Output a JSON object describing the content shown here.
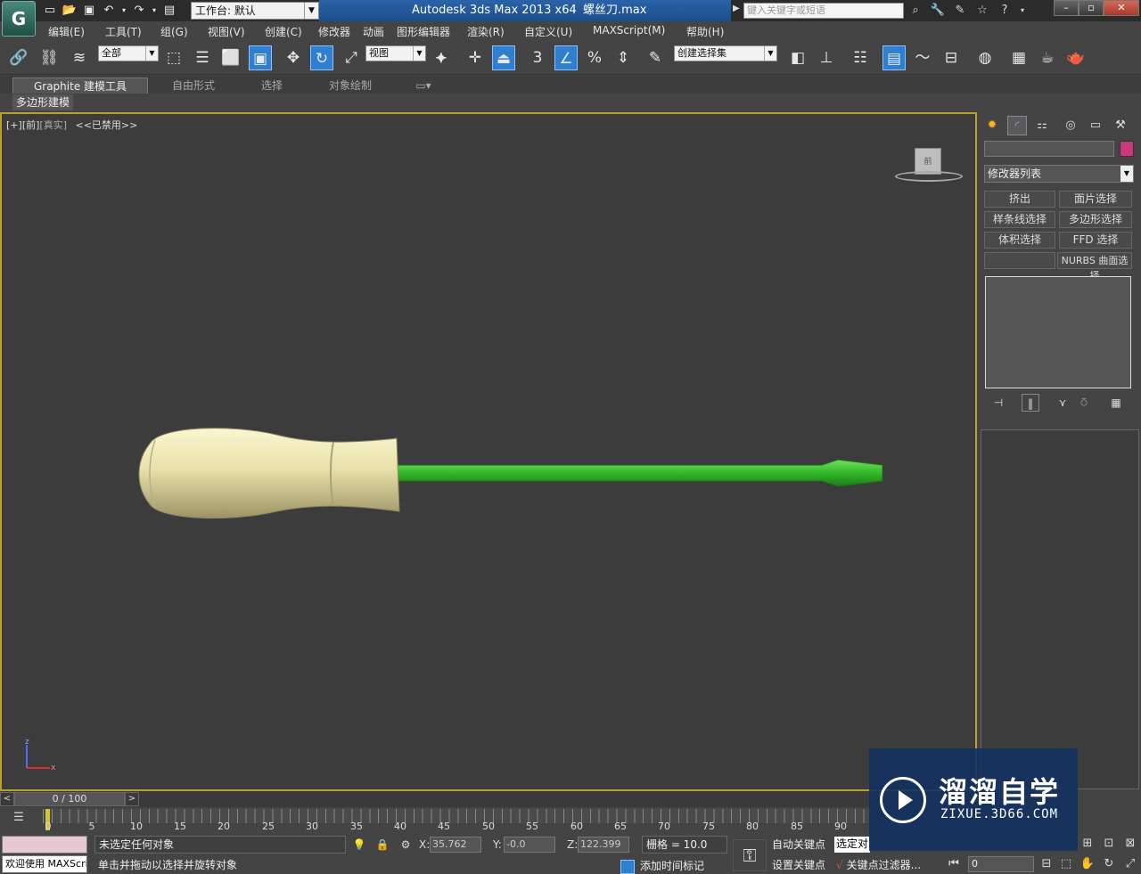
{
  "title_bar": {
    "app_logo": "G",
    "workspace_label": "工作台: 默认",
    "app_title": "Autodesk 3ds Max  2013 x64",
    "file_name": "螺丝刀.max",
    "search_placeholder": "键入关键字或短语",
    "window_controls": [
      "–",
      "▫",
      "✕"
    ]
  },
  "quick_access": [
    "new-icon",
    "open-icon",
    "save-icon",
    "undo-icon",
    "redo-icon",
    "project-icon"
  ],
  "menu": [
    "编辑(E)",
    "工具(T)",
    "组(G)",
    "视图(V)",
    "创建(C)",
    "修改器",
    "动画",
    "图形编辑器",
    "渲染(R)",
    "自定义(U)",
    "MAXScript(M)",
    "帮助(H)"
  ],
  "toolbar": {
    "selection_filter": "全部",
    "reference_coord": "视图",
    "named_selection_set": "创建选择集",
    "snap_value": "3"
  },
  "ribbon": {
    "tabs": [
      "Graphite 建模工具",
      "自由形式",
      "选择",
      "对象绘制"
    ],
    "active_sub": "多边形建模"
  },
  "viewport": {
    "label_plus": "[+]",
    "label_view": "[前]",
    "label_shading": "[真实]",
    "label_disabled": "<<已禁用>>",
    "viewcube_face": "前",
    "axis_x": "x",
    "axis_z": "z",
    "handle_color": "#e8e0aa",
    "shaft_color": "#33b82a"
  },
  "command_panel": {
    "tabs": [
      "create-icon",
      "modify-icon",
      "hierarchy-icon",
      "motion-icon",
      "display-icon",
      "utilities-icon"
    ],
    "object_color": "#c8387a",
    "modifier_list_label": "修改器列表",
    "modifier_buttons": [
      "挤出",
      "面片选择",
      "样条线选择",
      "多边形选择",
      "体积选择",
      "FFD 选择",
      "",
      "NURBS 曲面选择"
    ]
  },
  "timeline": {
    "frame_display": "0 / 100",
    "ticks": [
      "0",
      "5",
      "10",
      "15",
      "20",
      "25",
      "30",
      "35",
      "40",
      "45",
      "50",
      "55",
      "60",
      "65",
      "70",
      "75",
      "80",
      "85",
      "90"
    ]
  },
  "status": {
    "maxscript_welcome": "欢迎使用 MAXScript。",
    "selection_status": "未选定任何对象",
    "prompt": "单击并拖动以选择并旋转对象",
    "x_label": "X:",
    "x_value": "35.762",
    "y_label": "Y:",
    "y_value": "-0.0",
    "z_label": "Z:",
    "z_value": "122.399",
    "grid": "栅格 = 10.0",
    "add_time_tag": "添加时间标记",
    "auto_key": "自动关键点",
    "set_key": "设置关键点",
    "selected_label": "选定对象",
    "key_filters": "关键点过滤器...",
    "current_frame": "0"
  },
  "watermark": {
    "title": "溜溜自学",
    "url": "ZIXUE.3D66.COM"
  }
}
